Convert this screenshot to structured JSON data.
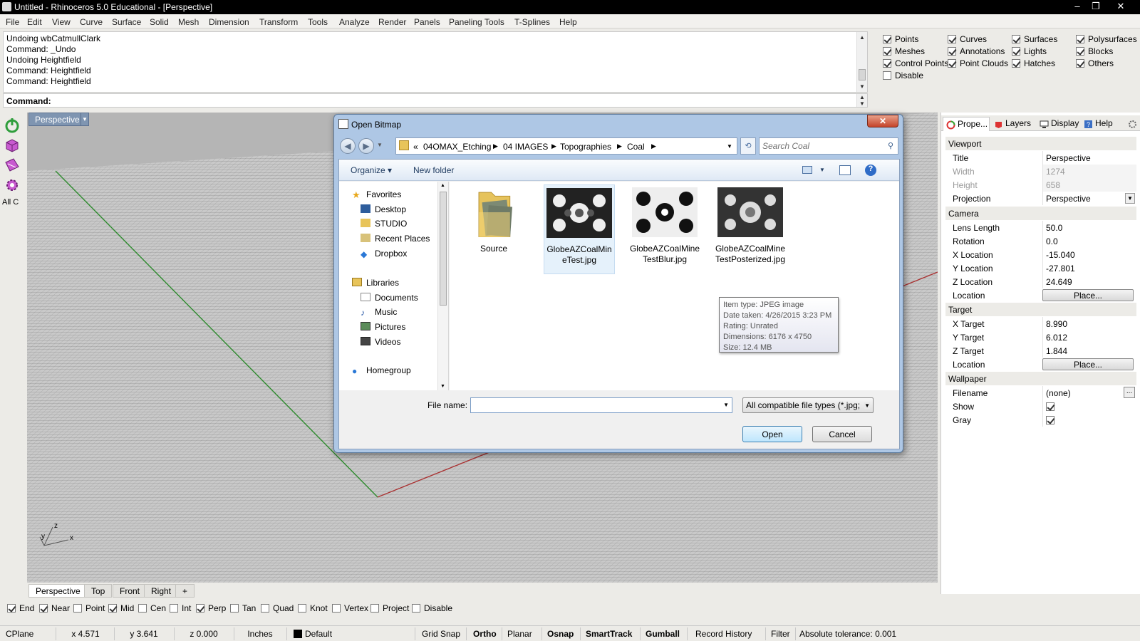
{
  "window": {
    "title": "Untitled - Rhinoceros 5.0 Educational - [Perspective]"
  },
  "menu": [
    "File",
    "Edit",
    "View",
    "Curve",
    "Surface",
    "Solid",
    "Mesh",
    "Dimension",
    "Transform",
    "Tools",
    "Analyze",
    "Render",
    "Panels",
    "Paneling Tools",
    "T-Splines",
    "Help"
  ],
  "command_history": [
    "Undoing wbCatmullClark",
    "Command: _Undo",
    "Undoing Heightfield",
    "Command: Heightfield",
    "Command: Heightfield"
  ],
  "command_prompt": "Command:",
  "filters": [
    {
      "label": "Points",
      "checked": true
    },
    {
      "label": "Curves",
      "checked": true
    },
    {
      "label": "Surfaces",
      "checked": true
    },
    {
      "label": "Polysurfaces",
      "checked": true
    },
    {
      "label": "Meshes",
      "checked": true
    },
    {
      "label": "Annotations",
      "checked": true
    },
    {
      "label": "Lights",
      "checked": true
    },
    {
      "label": "Blocks",
      "checked": true
    },
    {
      "label": "Control Points",
      "checked": true
    },
    {
      "label": "Point Clouds",
      "checked": true
    },
    {
      "label": "Hatches",
      "checked": true
    },
    {
      "label": "Others",
      "checked": true
    },
    {
      "label": "Disable",
      "checked": false
    }
  ],
  "left_toolbar": {
    "all_label": "All C"
  },
  "viewport": {
    "active_tab": "Perspective",
    "axis_labels": {
      "z": "z",
      "y": "y",
      "x": "x"
    }
  },
  "viewport_tabs": [
    "Perspective",
    "Top",
    "Front",
    "Right"
  ],
  "osnap": [
    {
      "label": "End",
      "checked": true
    },
    {
      "label": "Near",
      "checked": true
    },
    {
      "label": "Point",
      "checked": false
    },
    {
      "label": "Mid",
      "checked": true
    },
    {
      "label": "Cen",
      "checked": false
    },
    {
      "label": "Int",
      "checked": false
    },
    {
      "label": "Perp",
      "checked": true
    },
    {
      "label": "Tan",
      "checked": false
    },
    {
      "label": "Quad",
      "checked": false
    },
    {
      "label": "Knot",
      "checked": false
    },
    {
      "label": "Vertex",
      "checked": false
    },
    {
      "label": "Project",
      "checked": false
    },
    {
      "label": "Disable",
      "checked": false
    }
  ],
  "status": {
    "cplane": "CPlane",
    "x": "x 4.571",
    "y": "y 3.641",
    "z": "z 0.000",
    "units": "Inches",
    "layer": "Default",
    "grid_snap": "Grid Snap",
    "ortho": "Ortho",
    "planar": "Planar",
    "osnap": "Osnap",
    "smarttrack": "SmartTrack",
    "gumball": "Gumball",
    "record_history": "Record History",
    "filter": "Filter",
    "tolerance": "Absolute tolerance: 0.001"
  },
  "panel": {
    "tabs": [
      "Prope...",
      "Layers",
      "Display",
      "Help"
    ],
    "viewport_header": "Viewport",
    "title_k": "Title",
    "title_v": "Perspective",
    "width_k": "Width",
    "width_v": "1274",
    "height_k": "Height",
    "height_v": "658",
    "projection_k": "Projection",
    "projection_v": "Perspective",
    "camera_header": "Camera",
    "lens_k": "Lens Length",
    "lens_v": "50.0",
    "rotation_k": "Rotation",
    "rotation_v": "0.0",
    "xloc_k": "X Location",
    "xloc_v": "-15.040",
    "yloc_k": "Y Location",
    "yloc_v": "-27.801",
    "zloc_k": "Z Location",
    "zloc_v": "24.649",
    "location_k": "Location",
    "place_label": "Place...",
    "target_header": "Target",
    "xt_k": "X Target",
    "xt_v": "8.990",
    "yt_k": "Y Target",
    "yt_v": "6.012",
    "zt_k": "Z Target",
    "zt_v": "1.844",
    "wallpaper_header": "Wallpaper",
    "filename_k": "Filename",
    "filename_v": "(none)",
    "browse_label": "...",
    "show_k": "Show",
    "gray_k": "Gray"
  },
  "dialog": {
    "title": "Open Bitmap",
    "close_label": "✕",
    "breadcrumb": [
      "«",
      "04OMAX_Etching",
      "04 IMAGES",
      "Topographies",
      "Coal"
    ],
    "search_placeholder": "Search Coal",
    "organize": "Organize ▾",
    "new_folder": "New folder",
    "nav": {
      "favorites": "Favorites",
      "desktop": "Desktop",
      "studio": "STUDIO",
      "recent": "Recent Places",
      "dropbox": "Dropbox",
      "libraries": "Libraries",
      "documents": "Documents",
      "music": "Music",
      "pictures": "Pictures",
      "videos": "Videos",
      "homegroup": "Homegroup"
    },
    "files": [
      {
        "name": "Source",
        "kind": "folder"
      },
      {
        "name": "GlobeAZCoalMineTest.jpg",
        "kind": "image"
      },
      {
        "name": "GlobeAZCoalMineTestBlur.jpg",
        "kind": "image"
      },
      {
        "name": "GlobeAZCoalMineTestPosterized.jpg",
        "kind": "image"
      }
    ],
    "tooltip": [
      "Item type: JPEG image",
      "Date taken: 4/26/2015 3:23 PM",
      "Rating: Unrated",
      "Dimensions: 6176 x 4750",
      "Size: 12.4 MB"
    ],
    "filename_label": "File name:",
    "filename_value": "",
    "filetype": "All compatible file types (*.jpg;",
    "open": "Open",
    "cancel": "Cancel"
  }
}
